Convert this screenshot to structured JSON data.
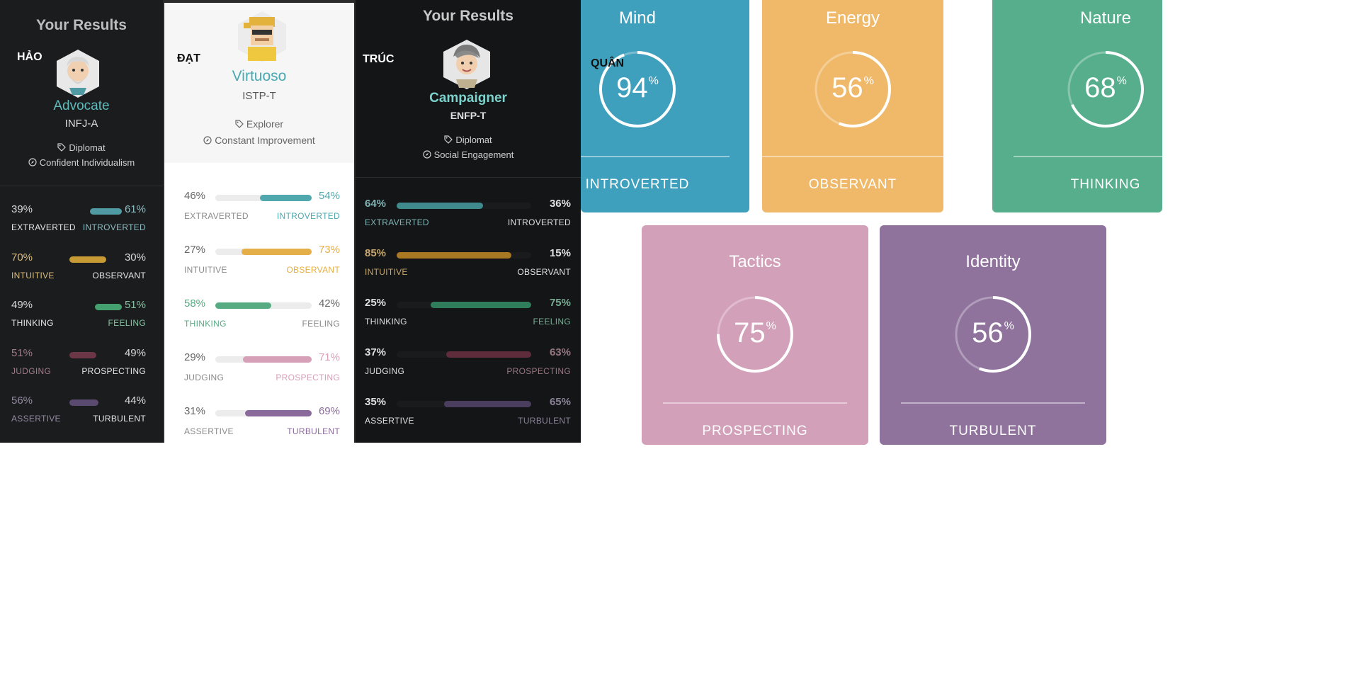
{
  "panels": [
    {
      "name_tag": "HẢO",
      "title": "Your Results",
      "type_name": "Advocate",
      "type_code": "INFJ-A",
      "role": "Diplomat",
      "strategy": "Confident Individualism",
      "theme": "dark",
      "traits": [
        {
          "left_pct": "39%",
          "right_pct": "61%",
          "left_label": "EXTRAVERTED",
          "right_label": "INTROVERTED",
          "value": 61,
          "side": "right",
          "color": "#4f9aa3",
          "active": "right"
        },
        {
          "left_pct": "70%",
          "right_pct": "30%",
          "left_label": "INTUITIVE",
          "right_label": "OBSERVANT",
          "value": 70,
          "side": "left",
          "color": "#c79a34",
          "active": "left"
        },
        {
          "left_pct": "49%",
          "right_pct": "51%",
          "left_label": "THINKING",
          "right_label": "FEELING",
          "value": 51,
          "side": "right",
          "color": "#44a06f",
          "active": "right"
        },
        {
          "left_pct": "51%",
          "right_pct": "49%",
          "left_label": "JUDGING",
          "right_label": "PROSPECTING",
          "value": 51,
          "side": "left",
          "color": "#6b3645",
          "active": "left"
        },
        {
          "left_pct": "56%",
          "right_pct": "44%",
          "left_label": "ASSERTIVE",
          "right_label": "TURBULENT",
          "value": 56,
          "side": "left",
          "color": "#5a4a70",
          "active": "left"
        }
      ]
    },
    {
      "name_tag": "ĐẠT",
      "type_name": "Virtuoso",
      "type_code": "ISTP-T",
      "role": "Explorer",
      "strategy": "Constant Improvement",
      "theme": "light",
      "traits": [
        {
          "left_pct": "46%",
          "right_pct": "54%",
          "left_label": "EXTRAVERTED",
          "right_label": "INTROVERTED",
          "value": 54,
          "side": "right",
          "color": "#4fa8ad",
          "active": "right"
        },
        {
          "left_pct": "27%",
          "right_pct": "73%",
          "left_label": "INTUITIVE",
          "right_label": "OBSERVANT",
          "value": 73,
          "side": "right",
          "color": "#e4ae48",
          "active": "right"
        },
        {
          "left_pct": "58%",
          "right_pct": "42%",
          "left_label": "THINKING",
          "right_label": "FEELING",
          "value": 58,
          "side": "left",
          "color": "#57ab83",
          "active": "left"
        },
        {
          "left_pct": "29%",
          "right_pct": "71%",
          "left_label": "JUDGING",
          "right_label": "PROSPECTING",
          "value": 71,
          "side": "right",
          "color": "#d6a0b8",
          "active": "right"
        },
        {
          "left_pct": "31%",
          "right_pct": "69%",
          "left_label": "ASSERTIVE",
          "right_label": "TURBULENT",
          "value": 69,
          "side": "right",
          "color": "#8a6a9b",
          "active": "right"
        }
      ]
    },
    {
      "name_tag": "TRÚC",
      "title": "Your Results",
      "type_name": "Campaigner",
      "type_code": "ENFP-T",
      "role": "Diplomat",
      "strategy": "Social Engagement",
      "theme": "dark",
      "traits": [
        {
          "left_pct": "64%",
          "right_pct": "36%",
          "left_label": "EXTRAVERTED",
          "right_label": "INTROVERTED",
          "value": 64,
          "side": "left",
          "color": "#3f8a8c",
          "active": "left"
        },
        {
          "left_pct": "85%",
          "right_pct": "15%",
          "left_label": "INTUITIVE",
          "right_label": "OBSERVANT",
          "value": 85,
          "side": "left",
          "color": "#a87822",
          "active": "left"
        },
        {
          "left_pct": "25%",
          "right_pct": "75%",
          "left_label": "THINKING",
          "right_label": "FEELING",
          "value": 75,
          "side": "right",
          "color": "#2f7d5a",
          "active": "right"
        },
        {
          "left_pct": "37%",
          "right_pct": "63%",
          "left_label": "JUDGING",
          "right_label": "PROSPECTING",
          "value": 63,
          "side": "right",
          "color": "#5e2c3a",
          "active": "right"
        },
        {
          "left_pct": "35%",
          "right_pct": "65%",
          "left_label": "ASSERTIVE",
          "right_label": "TURBULENT",
          "value": 65,
          "side": "right",
          "color": "#4a3d5d",
          "active": "right"
        }
      ]
    }
  ],
  "quan": {
    "name_tag": "QUÂN",
    "cards": [
      {
        "title": "Mind",
        "value": "94",
        "unit": "%",
        "label": "INTROVERTED",
        "color": "#3fa0be",
        "fraction": 0.94
      },
      {
        "title": "Energy",
        "value": "56",
        "unit": "%",
        "label": "OBSERVANT",
        "color": "#f0b96a",
        "fraction": 0.56
      },
      {
        "title": "Nature",
        "value": "68",
        "unit": "%",
        "label": "THINKING",
        "color": "#56ae8c",
        "fraction": 0.68
      },
      {
        "title": "Tactics",
        "value": "75",
        "unit": "%",
        "label": "PROSPECTING",
        "color": "#d3a0b9",
        "fraction": 0.75
      },
      {
        "title": "Identity",
        "value": "56",
        "unit": "%",
        "label": "TURBULENT",
        "color": "#8f739d",
        "fraction": 0.56
      }
    ]
  }
}
